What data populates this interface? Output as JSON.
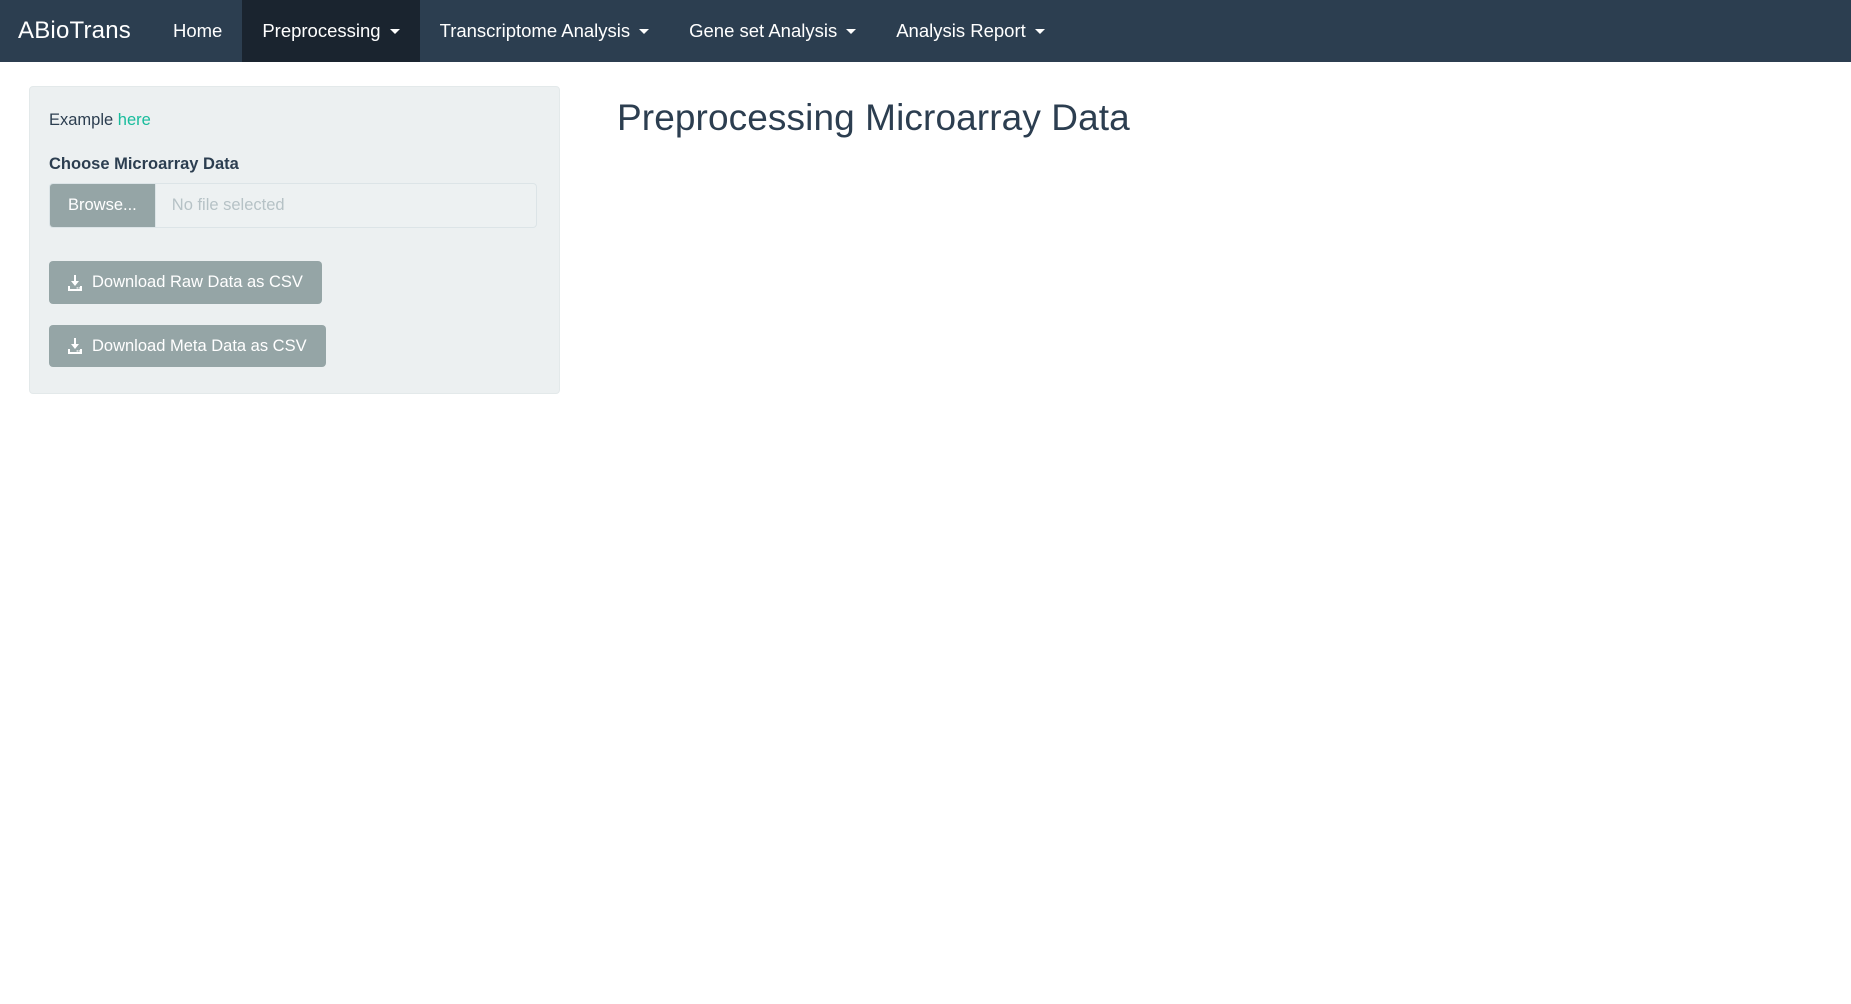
{
  "navbar": {
    "brand": "ABioTrans",
    "items": [
      {
        "label": "Home",
        "has_caret": false,
        "active": false
      },
      {
        "label": "Preprocessing",
        "has_caret": true,
        "active": true
      },
      {
        "label": "Transcriptome Analysis",
        "has_caret": true,
        "active": false
      },
      {
        "label": "Gene set Analysis",
        "has_caret": true,
        "active": false
      },
      {
        "label": "Analysis Report",
        "has_caret": true,
        "active": false
      }
    ],
    "background_color": "#2c3e50",
    "active_color": "#1a242f",
    "text_color": "#ffffff"
  },
  "sidebar": {
    "example_text": "Example",
    "example_link_label": "here",
    "link_color": "#18bc9c",
    "file_label": "Choose Microarray Data",
    "file_button_label": "Browse...",
    "file_placeholder": "No file selected",
    "download_raw_label": "Download Raw Data as CSV",
    "download_meta_label": "Download Meta Data as CSV",
    "panel_color": "#ecf0f1",
    "button_color": "#95a5a6"
  },
  "main": {
    "title": "Preprocessing Microarray Data"
  }
}
